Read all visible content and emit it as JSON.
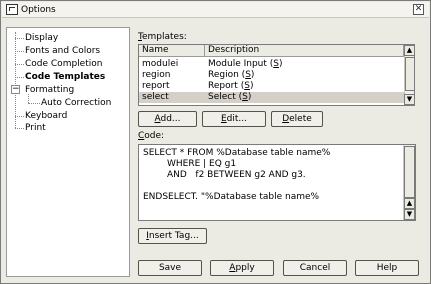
{
  "window": {
    "title": "Options",
    "close_glyph": "✕"
  },
  "tree": {
    "items": [
      {
        "label": "Display"
      },
      {
        "label": "Fonts and Colors"
      },
      {
        "label": "Code Completion"
      },
      {
        "label": "Code Templates",
        "selected": true
      },
      {
        "label": "Formatting",
        "expander": "−"
      },
      {
        "label": "Auto Correction"
      },
      {
        "label": "Keyboard"
      },
      {
        "label": "Print"
      }
    ]
  },
  "templates": {
    "label_mnemonic": "T",
    "label_rest": "emplates:",
    "columns": [
      "Name",
      "Description"
    ],
    "rows": [
      {
        "name": "modulei",
        "desc_pre": "Module Input (",
        "desc_key": "S",
        "desc_post": ")"
      },
      {
        "name": "region",
        "desc_pre": "Region (",
        "desc_key": "S",
        "desc_post": ")"
      },
      {
        "name": "report",
        "desc_pre": "Report (",
        "desc_key": "S",
        "desc_post": ")"
      },
      {
        "name": "select",
        "desc_pre": "Select (",
        "desc_key": "S",
        "desc_post": ")",
        "selected": true
      }
    ]
  },
  "buttons": {
    "add": {
      "mnemonic": "A",
      "rest": "dd..."
    },
    "edit": {
      "mnemonic": "E",
      "rest": "dit..."
    },
    "delete": {
      "mnemonic": "D",
      "rest": "elete"
    },
    "insert_tag": {
      "mnemonic": "I",
      "rest": "nsert Tag..."
    },
    "save": {
      "label": "Save"
    },
    "apply": {
      "mnemonic": "A",
      "rest": "pply"
    },
    "cancel": {
      "label": "Cancel"
    },
    "help": {
      "label": "Help"
    }
  },
  "code": {
    "label_mnemonic": "C",
    "label_rest": "ode:",
    "lines": [
      "SELECT * FROM %Database table name%",
      "WHERE | EQ g1",
      "AND   f2 BETWEEN g2 AND g3.",
      "",
      "ENDSELECT. \"%Database table name%"
    ]
  },
  "icons": {
    "scroll_up": "▲",
    "scroll_down": "▼"
  }
}
